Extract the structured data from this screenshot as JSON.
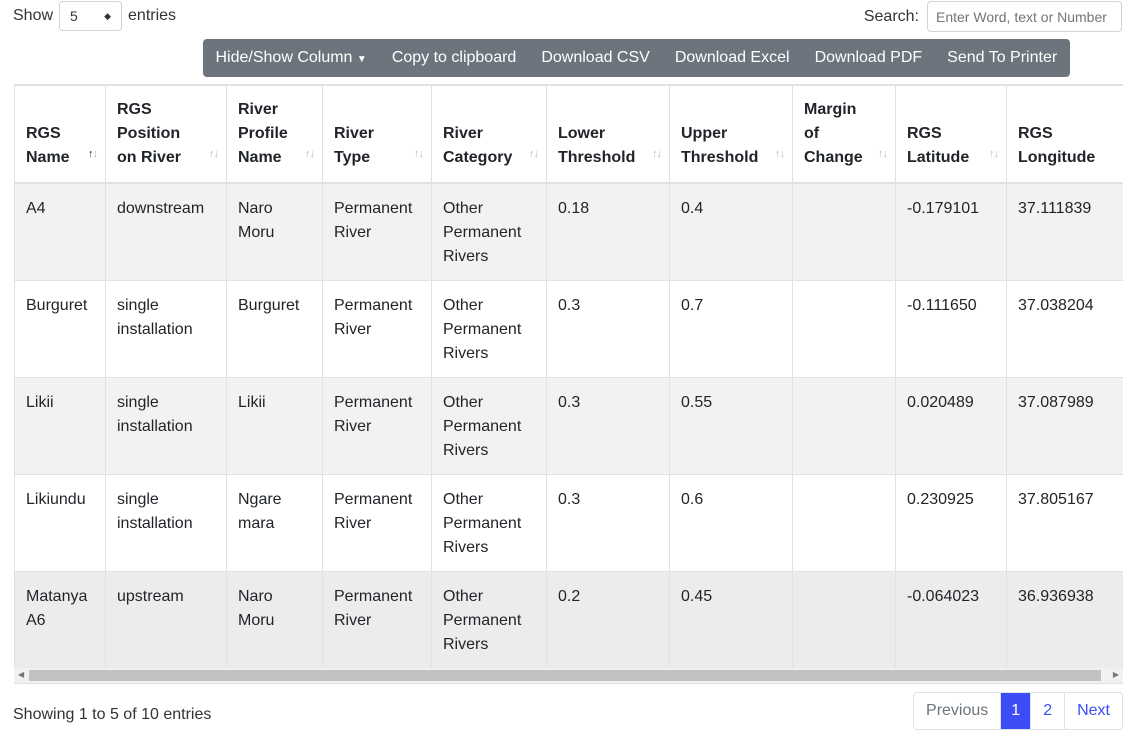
{
  "length": {
    "show": "Show",
    "value": "5",
    "entries": "entries"
  },
  "search": {
    "label": "Search:",
    "placeholder": "Enter Word, text or Number"
  },
  "buttons": [
    "Hide/Show Column",
    "Copy to clipboard",
    "Download CSV",
    "Download Excel",
    "Download PDF",
    "Send To Printer"
  ],
  "columns": [
    "RGS Name",
    "RGS Position on River",
    "River Profile Name",
    "River Type",
    "River Category",
    "Lower Threshold",
    "Upper Threshold",
    "Margin of Change",
    "RGS Latitude",
    "RGS Longitude"
  ],
  "rows": [
    [
      "A4",
      "downstream",
      "Naro Moru",
      "Permanent River",
      "Other Permanent Rivers",
      "0.18",
      "0.4",
      "",
      "-0.179101",
      "37.111839"
    ],
    [
      "Burguret",
      "single installation",
      "Burguret",
      "Permanent River",
      "Other Permanent Rivers",
      "0.3",
      "0.7",
      "",
      "-0.111650",
      "37.038204"
    ],
    [
      "Likii",
      "single installation",
      "Likii",
      "Permanent River",
      "Other Permanent Rivers",
      "0.3",
      "0.55",
      "",
      "0.020489",
      "37.087989"
    ],
    [
      "Likiundu",
      "single installation",
      "Ngare mara",
      "Permanent River",
      "Other Permanent Rivers",
      "0.3",
      "0.6",
      "",
      "0.230925",
      "37.805167"
    ],
    [
      "Matanya A6",
      "upstream",
      "Naro Moru",
      "Permanent River",
      "Other Permanent Rivers",
      "0.2",
      "0.45",
      "",
      "-0.064023",
      "36.936938"
    ]
  ],
  "info": "Showing 1 to 5 of 10 entries",
  "pagination": {
    "previous": "Previous",
    "pages": [
      "1",
      "2"
    ],
    "current": "1",
    "next": "Next"
  },
  "colors": {
    "accent": "#3c4cf7",
    "button_bar": "#6c757d"
  }
}
